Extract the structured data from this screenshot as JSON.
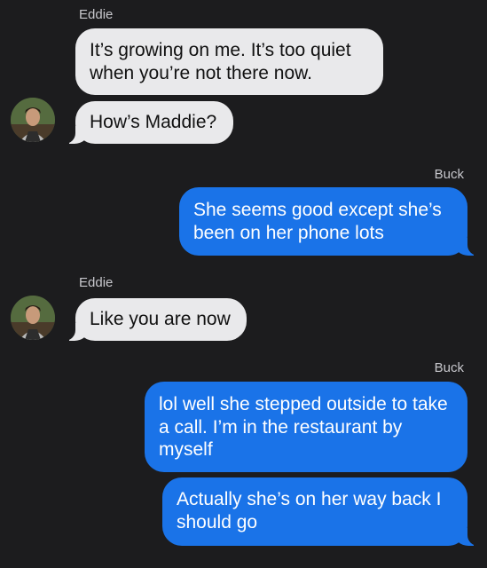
{
  "messages": [
    {
      "sender": "Eddie",
      "text": "It’s growing on me. It’s too quiet when you’re not there now."
    },
    {
      "text": "How’s Maddie?"
    },
    {
      "sender": "Buck",
      "text": "She seems good except she’s been on her phone lots"
    },
    {
      "sender": "Eddie",
      "text": "Like you are now"
    },
    {
      "sender": "Buck",
      "text": "lol well she stepped outside to take a call. I’m in the restaurant by myself"
    },
    {
      "text": "Actually she’s on her way back I should go"
    }
  ],
  "colors": {
    "background": "#1c1c1e",
    "incoming_bubble": "#e9e9eb",
    "outgoing_bubble": "#1a73e8"
  }
}
